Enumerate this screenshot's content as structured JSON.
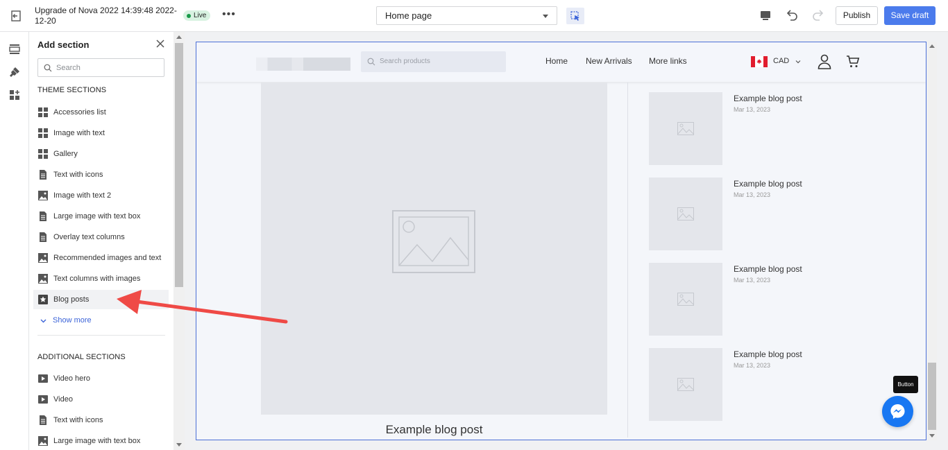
{
  "topbar": {
    "title": "Upgrade of Nova 2022 14:39:48 2022-12-20",
    "status_badge": "Live",
    "page_selector": "Home page",
    "publish_label": "Publish",
    "save_label": "Save draft"
  },
  "panel": {
    "title": "Add section",
    "search_placeholder": "Search",
    "theme_heading": "THEME SECTIONS",
    "theme_items": [
      {
        "label": "Accessories list",
        "icon": "grid-icon"
      },
      {
        "label": "Image with text",
        "icon": "grid-icon"
      },
      {
        "label": "Gallery",
        "icon": "grid-icon"
      },
      {
        "label": "Text with icons",
        "icon": "document-icon"
      },
      {
        "label": "Image with text 2",
        "icon": "image-icon"
      },
      {
        "label": "Large image with text box",
        "icon": "document-icon"
      },
      {
        "label": "Overlay text columns",
        "icon": "document-icon"
      },
      {
        "label": "Recommended images and text",
        "icon": "image-icon"
      },
      {
        "label": "Text columns with images",
        "icon": "image-icon"
      },
      {
        "label": "Blog posts",
        "icon": "bookmark-star-icon"
      }
    ],
    "show_more": "Show more",
    "additional_heading": "ADDITIONAL SECTIONS",
    "additional_items": [
      {
        "label": "Video hero",
        "icon": "play-icon"
      },
      {
        "label": "Video",
        "icon": "play-icon"
      },
      {
        "label": "Text with icons",
        "icon": "document-icon"
      },
      {
        "label": "Large image with text box",
        "icon": "image-icon"
      }
    ]
  },
  "store": {
    "search_placeholder": "Search products",
    "nav": [
      "Home",
      "New Arrivals",
      "More links"
    ],
    "currency": "CAD",
    "hero_post_title": "Example blog post",
    "posts": [
      {
        "title": "Example blog post",
        "date": "Mar 13, 2023"
      },
      {
        "title": "Example blog post",
        "date": "Mar 13, 2023"
      },
      {
        "title": "Example blog post",
        "date": "Mar 13, 2023"
      },
      {
        "title": "Example blog post",
        "date": "Mar 13, 2023"
      }
    ]
  },
  "tooltip": "Button",
  "colors": {
    "accent": "#4b7bec",
    "live_badge": "#d8f2e1",
    "arrow": "#ef4a46",
    "messenger": "#1877f2"
  }
}
